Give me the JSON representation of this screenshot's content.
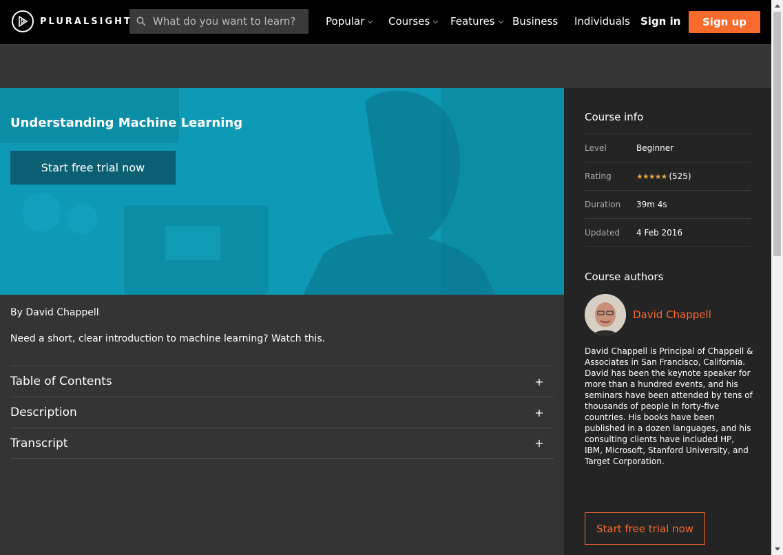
{
  "header": {
    "brand": "PLURALSIGHT",
    "search_placeholder": "What do you want to learn?",
    "nav": [
      {
        "label": "Popular"
      },
      {
        "label": "Courses"
      },
      {
        "label": "Features"
      },
      {
        "label": "Business"
      },
      {
        "label": "Individuals"
      }
    ],
    "signin_label": "Sign in",
    "signup_label": "Sign up"
  },
  "hero": {
    "title": "Understanding Machine Learning",
    "cta_label": "Start free trial now"
  },
  "main": {
    "byline": "By David Chappell",
    "summary": "Need a short, clear introduction to machine learning? Watch this.",
    "sections": [
      {
        "label": "Table of Contents",
        "icon": "+"
      },
      {
        "label": "Description",
        "icon": "+"
      },
      {
        "label": "Transcript",
        "icon": "+"
      }
    ]
  },
  "sidebar": {
    "info_heading": "Course info",
    "info": [
      {
        "label": "Level",
        "value": "Beginner"
      },
      {
        "label": "Rating",
        "value": "(525)",
        "stars": "★★★★★"
      },
      {
        "label": "Duration",
        "value": "39m 4s"
      },
      {
        "label": "Updated",
        "value": "4 Feb 2016"
      }
    ],
    "authors_heading": "Course authors",
    "author_name": "David Chappell",
    "author_bio": "David Chappell is Principal of Chappell & Associates in San Francisco, California. David has been the keynote speaker for more than a hundred events, and his seminars have been attended by tens of thousands of people in forty-five countries. His books have been published in a dozen languages, and his consulting clients have included HP, IBM, Microsoft, Stanford University, and Target Corporation.",
    "cta_label": "Start free trial now"
  },
  "colors": {
    "accent": "#f96b2d",
    "hero": "#0e9ab5",
    "hero_button": "#0b5f73",
    "topbar": "#000000",
    "sidebar": "#242424",
    "page": "#343434"
  }
}
